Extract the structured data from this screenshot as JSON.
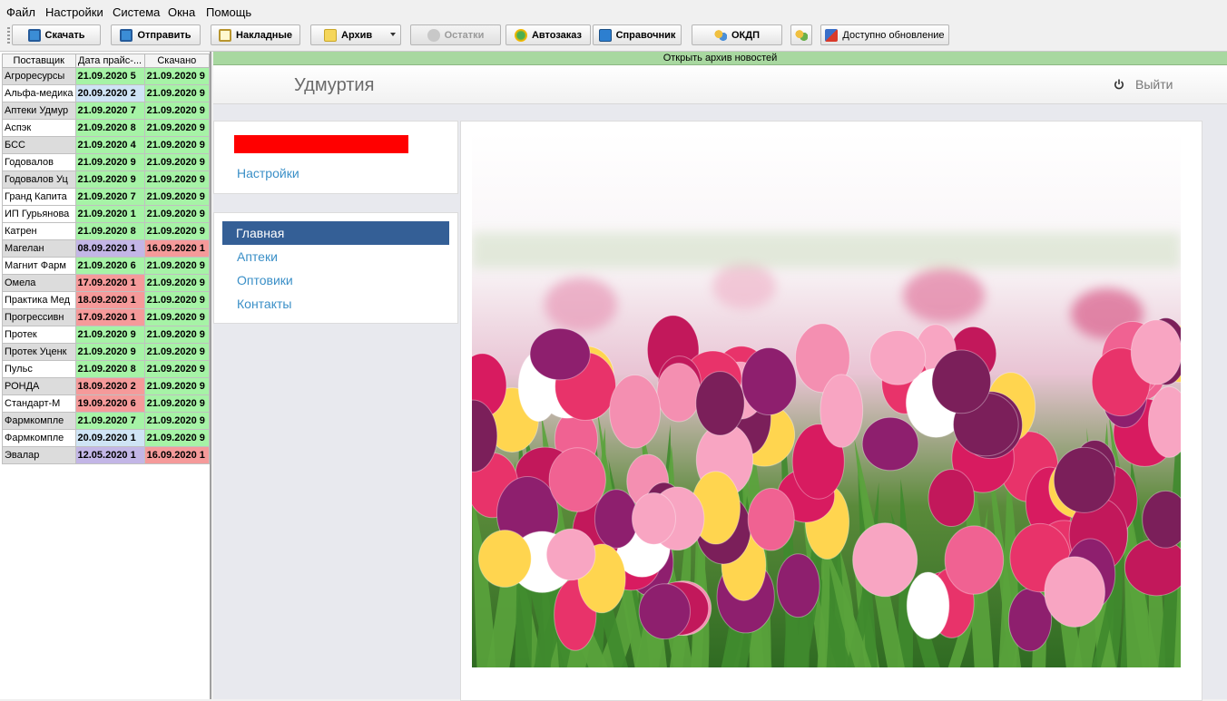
{
  "menu": [
    "Файл",
    "Настройки",
    "Система",
    "Окна",
    "Помощь"
  ],
  "toolbar": {
    "download": "Скачать",
    "send": "Отправить",
    "invoices": "Накладные",
    "archive": "Архив",
    "stock": "Остатки",
    "autoorder": "Автозаказ",
    "directory": "Справочник",
    "okdp": "ОКДП",
    "update": "Доступно обновление"
  },
  "grid": {
    "headers": [
      "Поставщик",
      "Дата прайс-...",
      "Скачано"
    ],
    "rows": [
      {
        "supplier": "Агроресурсы",
        "price_date": "21.09.2020 5",
        "downloaded": "21.09.2020 9"
      },
      {
        "supplier": "Альфа-медика",
        "price_date": "20.09.2020 2",
        "downloaded": "21.09.2020 9"
      },
      {
        "supplier": "Аптеки Удмур",
        "price_date": "21.09.2020 7",
        "downloaded": "21.09.2020 9"
      },
      {
        "supplier": "Аспэк",
        "price_date": "21.09.2020 8",
        "downloaded": "21.09.2020 9"
      },
      {
        "supplier": "БСС",
        "price_date": "21.09.2020 4",
        "downloaded": "21.09.2020 9"
      },
      {
        "supplier": "Годовалов",
        "price_date": "21.09.2020 9",
        "downloaded": "21.09.2020 9"
      },
      {
        "supplier": "Годовалов Уц",
        "price_date": "21.09.2020 9",
        "downloaded": "21.09.2020 9"
      },
      {
        "supplier": "Гранд Капита",
        "price_date": "21.09.2020 7",
        "downloaded": "21.09.2020 9"
      },
      {
        "supplier": "ИП Гурьянова",
        "price_date": "21.09.2020 1",
        "downloaded": "21.09.2020 9"
      },
      {
        "supplier": "Катрен",
        "price_date": "21.09.2020 8",
        "downloaded": "21.09.2020 9"
      },
      {
        "supplier": "Магелан",
        "price_date": "08.09.2020 1",
        "downloaded": "16.09.2020 1"
      },
      {
        "supplier": "Магнит Фарм",
        "price_date": "21.09.2020 6",
        "downloaded": "21.09.2020 9"
      },
      {
        "supplier": "Омела",
        "price_date": "17.09.2020 1",
        "downloaded": "21.09.2020 9"
      },
      {
        "supplier": "Практика Мед",
        "price_date": "18.09.2020 1",
        "downloaded": "21.09.2020 9"
      },
      {
        "supplier": "Прогрессивн",
        "price_date": "17.09.2020 1",
        "downloaded": "21.09.2020 9"
      },
      {
        "supplier": "Протек",
        "price_date": "21.09.2020 9",
        "downloaded": "21.09.2020 9"
      },
      {
        "supplier": "Протек Уценк",
        "price_date": "21.09.2020 9",
        "downloaded": "21.09.2020 9"
      },
      {
        "supplier": "Пульс",
        "price_date": "21.09.2020 8",
        "downloaded": "21.09.2020 9"
      },
      {
        "supplier": "РОНДА",
        "price_date": "18.09.2020 2",
        "downloaded": "21.09.2020 9"
      },
      {
        "supplier": "Стандарт-М",
        "price_date": "19.09.2020 6",
        "downloaded": "21.09.2020 9"
      },
      {
        "supplier": "Фармкомпле",
        "price_date": "21.09.2020 7",
        "downloaded": "21.09.2020 9"
      },
      {
        "supplier": "Фармкомпле",
        "price_date": "20.09.2020 1",
        "downloaded": "21.09.2020 9"
      },
      {
        "supplier": "Эвалар",
        "price_date": "12.05.2020 1",
        "downloaded": "16.09.2020 1"
      }
    ]
  },
  "colors": {
    "fresh": "#a6f3a6",
    "stale": "#f59a9a",
    "recent": "#cfe4f5",
    "old": "#c3b6e6",
    "nav_active": "#345f96",
    "link": "#3a8fc7"
  },
  "news_bar": "Открыть архив новостей",
  "header": {
    "region": "Удмуртия",
    "logout": "Выйти"
  },
  "account": {
    "settings_link": "Настройки"
  },
  "nav": {
    "items": [
      "Главная",
      "Аптеки",
      "Оптовики",
      "Контакты"
    ],
    "active": 0
  }
}
